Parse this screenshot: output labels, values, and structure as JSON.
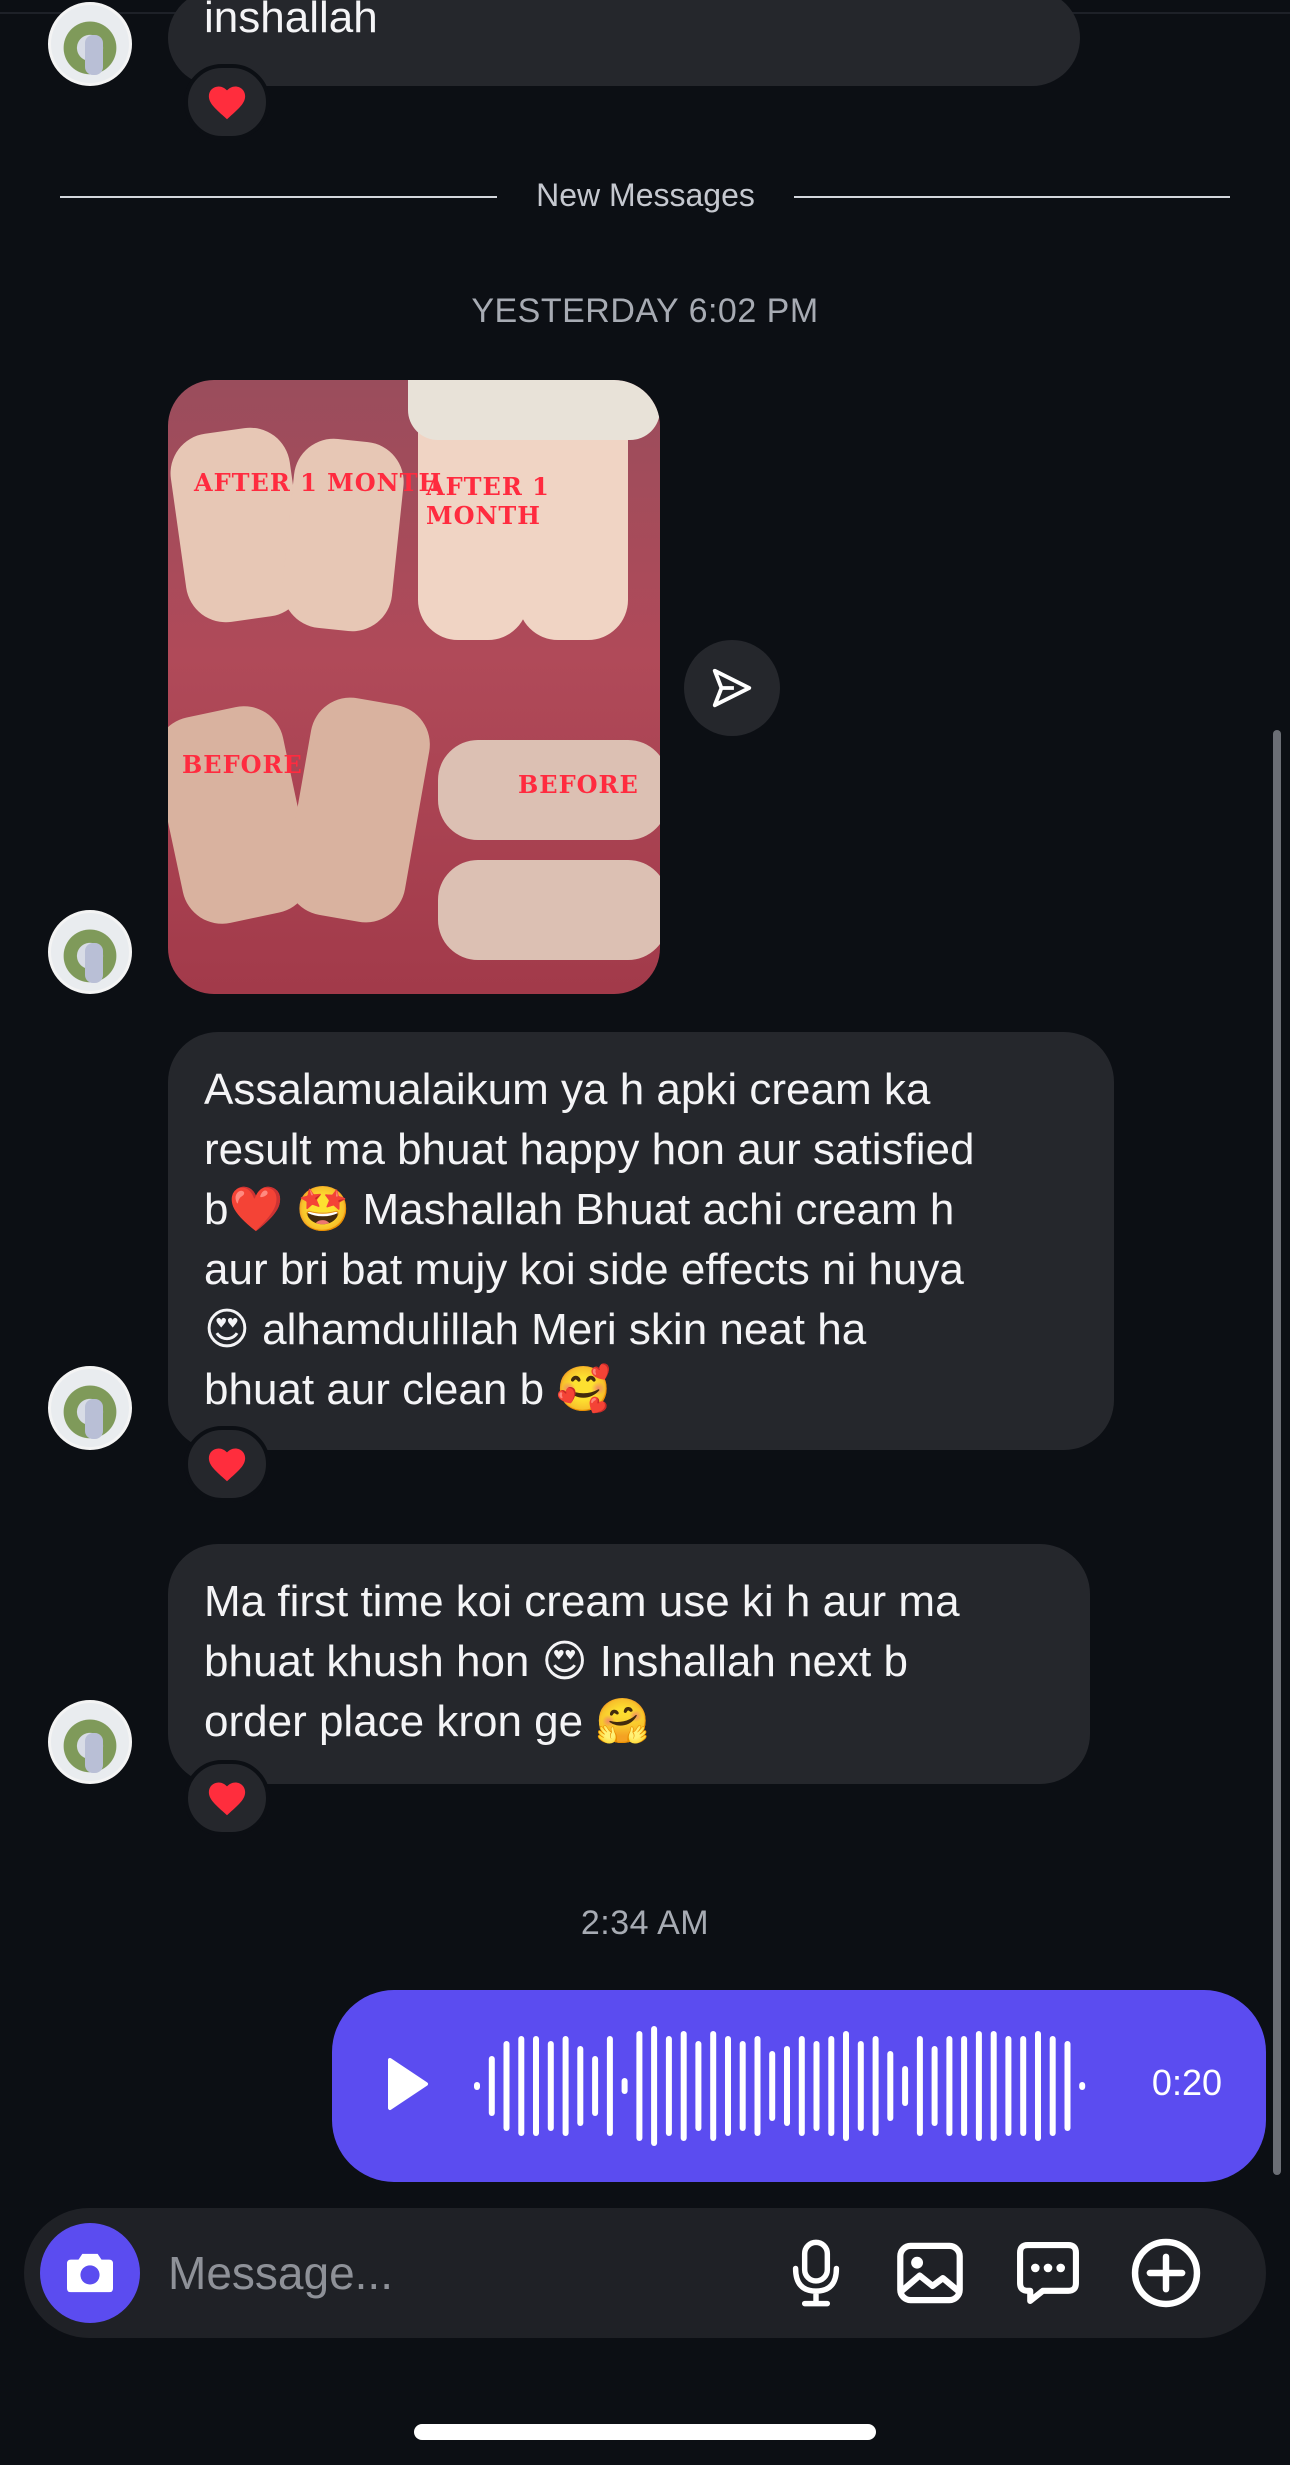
{
  "thread": {
    "previous_message": "inshallah",
    "reaction_emoji": "heart",
    "new_messages_label": "New Messages",
    "timestamp_1": "YESTERDAY 6:02 PM",
    "photo_captions": [
      "AFTER 1 MONTH",
      "AFTER 1 MONTH",
      "BEFORE",
      "BEFORE"
    ],
    "message_1_lines": [
      "Assalamualaikum ya h apki cream ka",
      "result ma bhuat happy hon aur satisfied",
      "b❤️ 🤩 Mashallah Bhuat achi cream h",
      "aur bri bat mujy koi side effects ni huya",
      "😍 alhamdulillah Meri skin neat ha",
      "bhuat aur clean b 🥰"
    ],
    "message_2_lines": [
      "Ma first time koi cream use ki h aur ma",
      "bhuat khush hon 😍 Inshallah next b",
      "order place kron ge 🤗"
    ],
    "timestamp_2": "2:34 AM",
    "voice_message": {
      "duration": "0:20",
      "accent": "#5b4cf0"
    }
  },
  "composer": {
    "placeholder": "Message...",
    "icons": [
      "camera-icon",
      "microphone-icon",
      "gallery-icon",
      "sticker-chat-icon",
      "plus-icon"
    ]
  },
  "colors": {
    "background": "#0c0f14",
    "bubble": "#25272c",
    "accent": "#5b4cf0"
  }
}
